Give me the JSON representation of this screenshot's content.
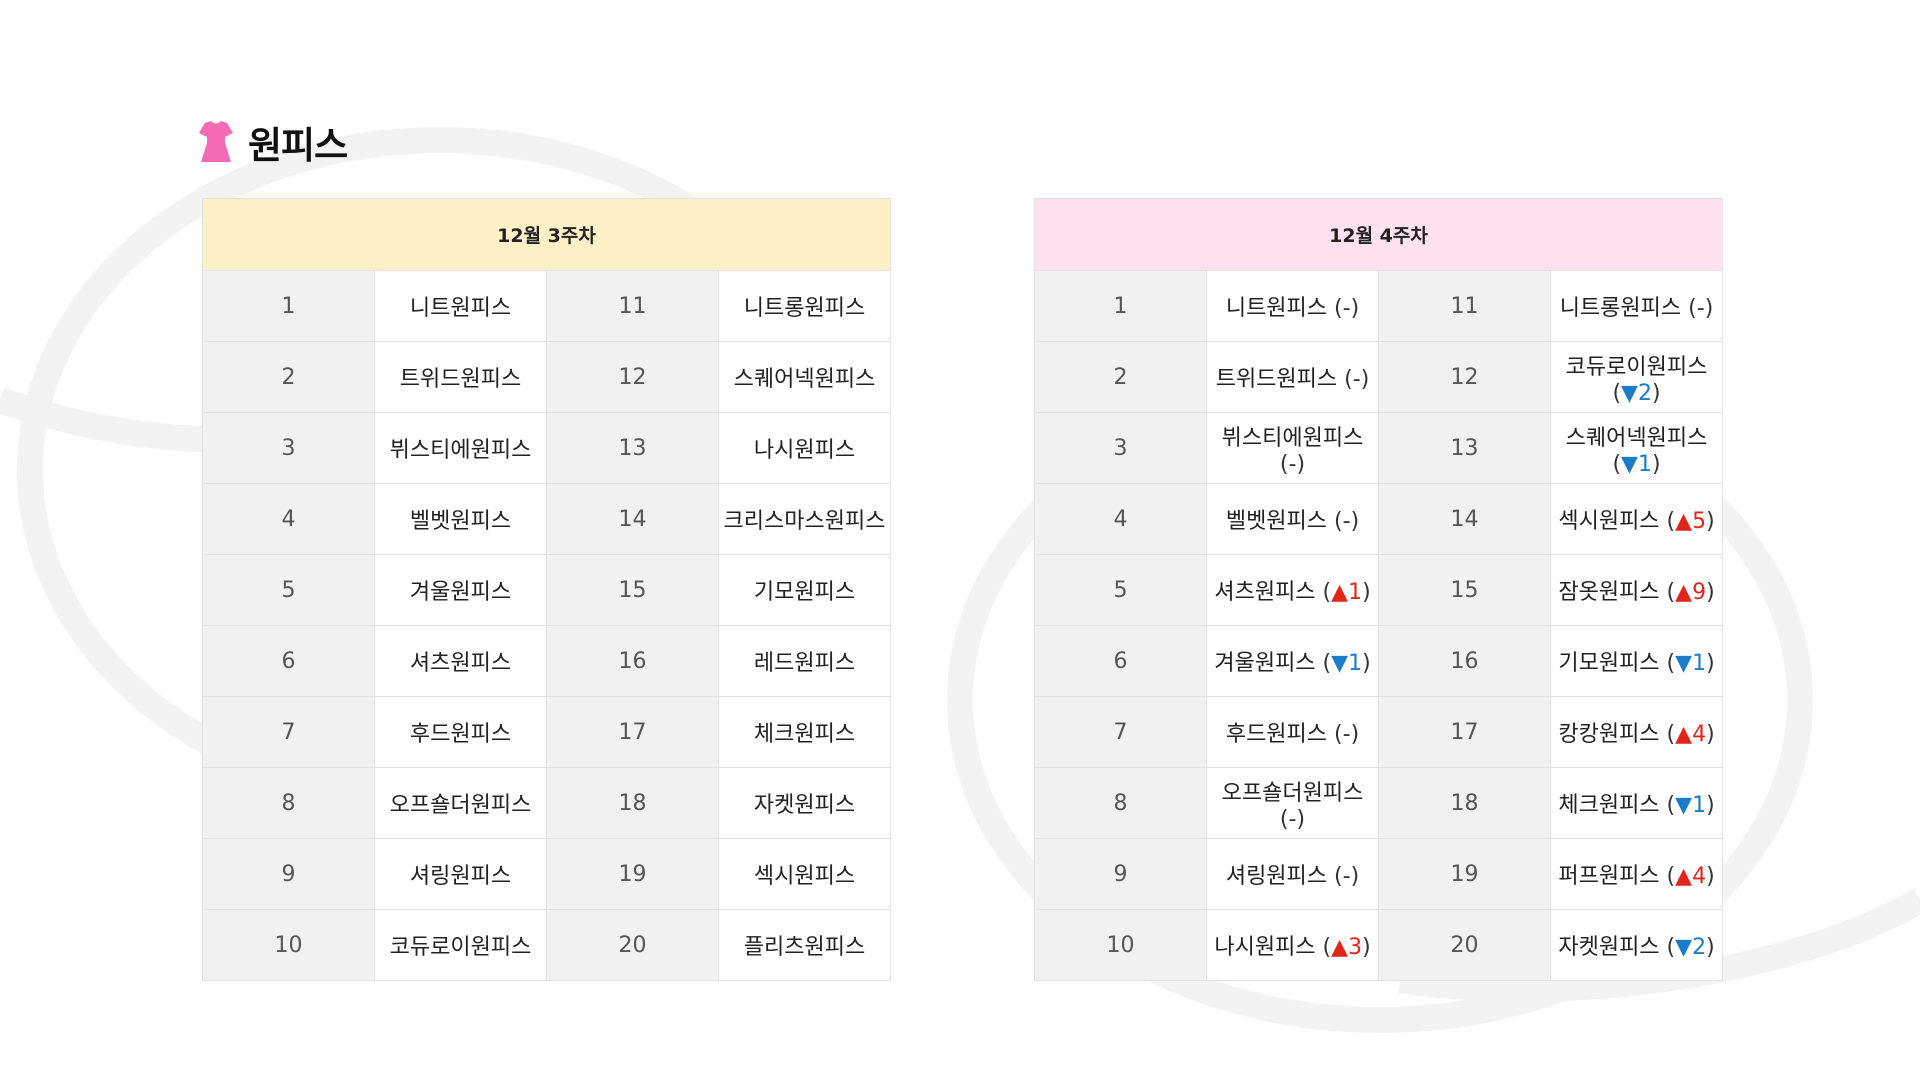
{
  "page": {
    "title": "원피스",
    "icon": "dress-icon",
    "icon_color": "#f46bb4"
  },
  "week_left": {
    "header": "12월 3주차",
    "header_color": "#fdf0c6",
    "rows": [
      {
        "rank_a": "1",
        "item_a": "니트원피스",
        "rank_b": "11",
        "item_b": "니트롱원피스"
      },
      {
        "rank_a": "2",
        "item_a": "트위드원피스",
        "rank_b": "12",
        "item_b": "스퀘어넥원피스"
      },
      {
        "rank_a": "3",
        "item_a": "뷔스티에원피스",
        "rank_b": "13",
        "item_b": "나시원피스"
      },
      {
        "rank_a": "4",
        "item_a": "벨벳원피스",
        "rank_b": "14",
        "item_b": "크리스마스원피스"
      },
      {
        "rank_a": "5",
        "item_a": "겨울원피스",
        "rank_b": "15",
        "item_b": "기모원피스"
      },
      {
        "rank_a": "6",
        "item_a": "셔츠원피스",
        "rank_b": "16",
        "item_b": "레드원피스"
      },
      {
        "rank_a": "7",
        "item_a": "후드원피스",
        "rank_b": "17",
        "item_b": "체크원피스"
      },
      {
        "rank_a": "8",
        "item_a": "오프숄더원피스",
        "rank_b": "18",
        "item_b": "자켓원피스"
      },
      {
        "rank_a": "9",
        "item_a": "셔링원피스",
        "rank_b": "19",
        "item_b": "섹시원피스"
      },
      {
        "rank_a": "10",
        "item_a": "코듀로이원피스",
        "rank_b": "20",
        "item_b": "플리츠원피스"
      }
    ]
  },
  "week_right": {
    "header": "12월 4주차",
    "header_color": "#fde1ee",
    "up_color": "#e0261b",
    "down_color": "#1a7cc9",
    "rows": [
      {
        "rank_a": "1",
        "item_a": "니트원피스",
        "dir_a": "same",
        "arrow_a": "",
        "chg_a": "-",
        "rank_b": "11",
        "item_b": "니트롱원피스",
        "dir_b": "same",
        "arrow_b": "",
        "chg_b": "-"
      },
      {
        "rank_a": "2",
        "item_a": "트위드원피스",
        "dir_a": "same",
        "arrow_a": "",
        "chg_a": "-",
        "rank_b": "12",
        "item_b": "코듀로이원피스",
        "dir_b": "down",
        "arrow_b": "▼",
        "chg_b": "2"
      },
      {
        "rank_a": "3",
        "item_a": "뷔스티에원피스",
        "dir_a": "same",
        "arrow_a": "",
        "chg_a": "-",
        "rank_b": "13",
        "item_b": "스퀘어넥원피스",
        "dir_b": "down",
        "arrow_b": "▼",
        "chg_b": "1"
      },
      {
        "rank_a": "4",
        "item_a": "벨벳원피스",
        "dir_a": "same",
        "arrow_a": "",
        "chg_a": "-",
        "rank_b": "14",
        "item_b": "섹시원피스",
        "dir_b": "up",
        "arrow_b": "▲",
        "chg_b": "5"
      },
      {
        "rank_a": "5",
        "item_a": "셔츠원피스",
        "dir_a": "up",
        "arrow_a": "▲",
        "chg_a": "1",
        "rank_b": "15",
        "item_b": "잠옷원피스",
        "dir_b": "up",
        "arrow_b": "▲",
        "chg_b": "9"
      },
      {
        "rank_a": "6",
        "item_a": "겨울원피스",
        "dir_a": "down",
        "arrow_a": "▼",
        "chg_a": "1",
        "rank_b": "16",
        "item_b": "기모원피스",
        "dir_b": "down",
        "arrow_b": "▼",
        "chg_b": "1"
      },
      {
        "rank_a": "7",
        "item_a": "후드원피스",
        "dir_a": "same",
        "arrow_a": "",
        "chg_a": "-",
        "rank_b": "17",
        "item_b": "캉캉원피스",
        "dir_b": "up",
        "arrow_b": "▲",
        "chg_b": "4"
      },
      {
        "rank_a": "8",
        "item_a": "오프숄더원피스",
        "dir_a": "same",
        "arrow_a": "",
        "chg_a": "-",
        "rank_b": "18",
        "item_b": "체크원피스",
        "dir_b": "down",
        "arrow_b": "▼",
        "chg_b": "1"
      },
      {
        "rank_a": "9",
        "item_a": "셔링원피스",
        "dir_a": "same",
        "arrow_a": "",
        "chg_a": "-",
        "rank_b": "19",
        "item_b": "퍼프원피스",
        "dir_b": "up",
        "arrow_b": "▲",
        "chg_b": "4"
      },
      {
        "rank_a": "10",
        "item_a": "나시원피스",
        "dir_a": "up",
        "arrow_a": "▲",
        "chg_a": "3",
        "rank_b": "20",
        "item_b": "자켓원피스",
        "dir_b": "down",
        "arrow_b": "▼",
        "chg_b": "2"
      }
    ]
  }
}
